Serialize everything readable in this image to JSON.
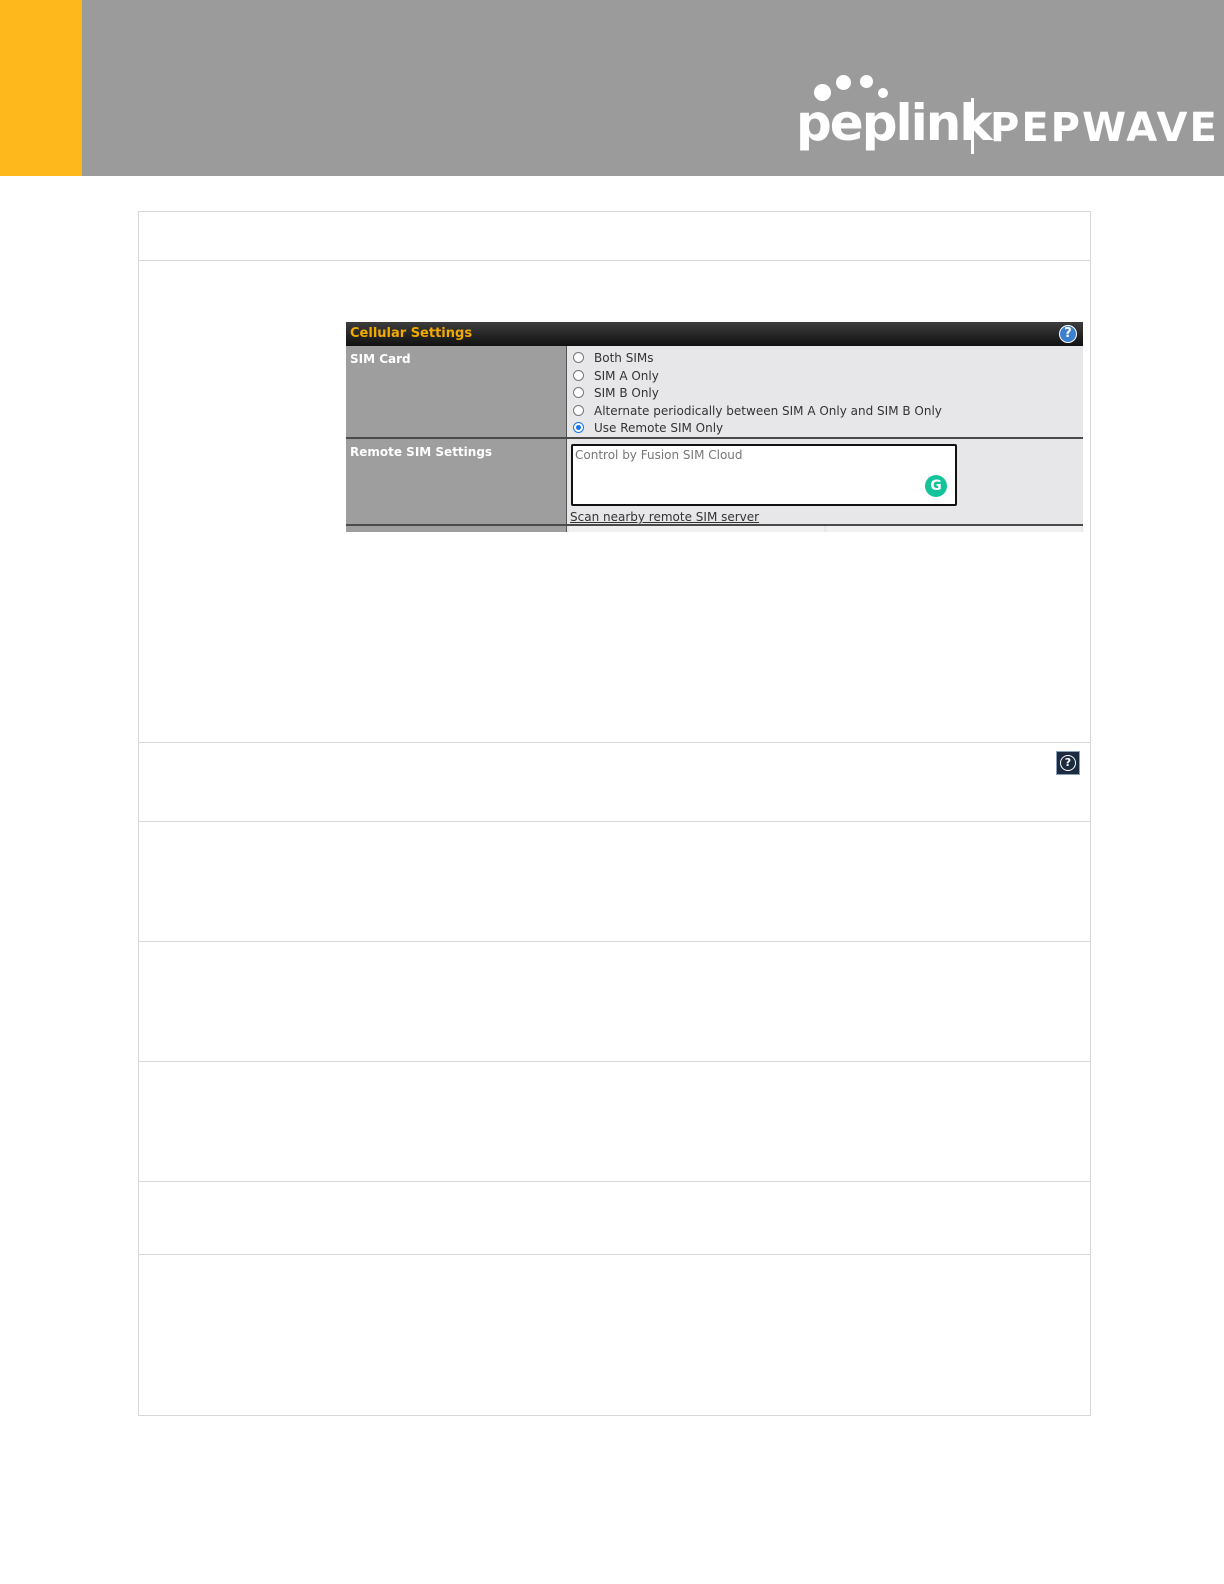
{
  "header": {
    "brand_left": "peplink",
    "brand_right": "PEPWAVE",
    "colors": {
      "banner": "#9b9b9b",
      "accent": "#ffb81c"
    }
  },
  "settings": {
    "title": "Cellular Settings",
    "help_icon": "help-icon",
    "sim_card": {
      "label": "SIM Card",
      "options": [
        {
          "label": "Both SIMs",
          "checked": false
        },
        {
          "label": "SIM A Only",
          "checked": false
        },
        {
          "label": "SIM B Only",
          "checked": false
        },
        {
          "label": "Alternate periodically between SIM A Only and SIM B Only",
          "checked": false
        },
        {
          "label": "Use Remote SIM Only",
          "checked": true
        }
      ]
    },
    "remote_sim": {
      "label": "Remote SIM Settings",
      "textarea_value": "Control by Fusion SIM Cloud",
      "grammarly_glyph": "G",
      "scan_link": "Scan nearby remote SIM server"
    }
  },
  "help_glyph": "?"
}
